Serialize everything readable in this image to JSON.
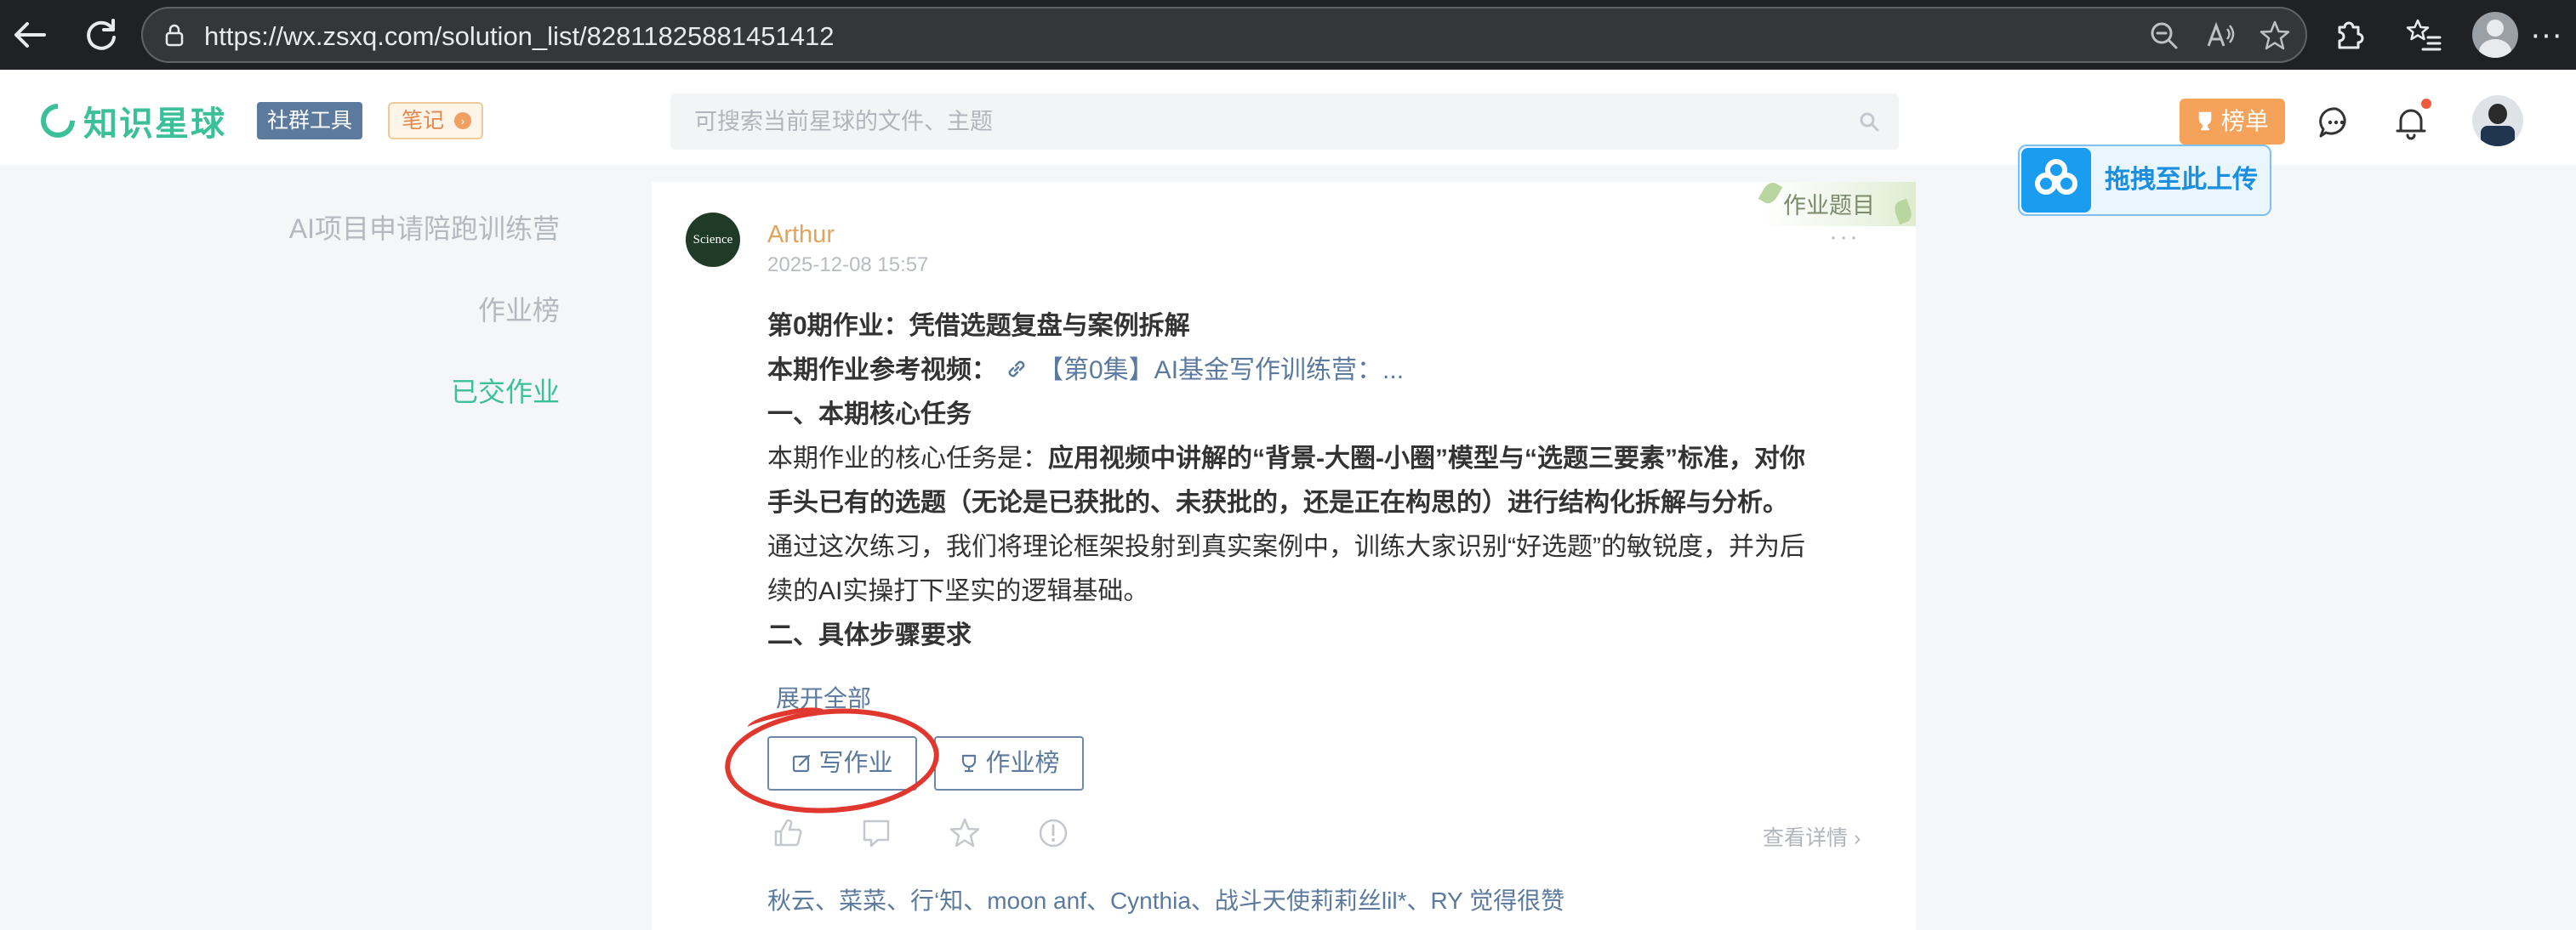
{
  "browser": {
    "url": "https://wx.zsxq.com/solution_list/82811825881451412",
    "more": "···"
  },
  "header": {
    "logo_text": "知识星球",
    "tools_tag": "社群工具",
    "notes_tag": "笔记",
    "search_placeholder": "可搜索当前星球的文件、主题",
    "rank_button": "榜单"
  },
  "upload": {
    "label": "拖拽至此上传"
  },
  "sidebar": {
    "items": [
      {
        "label": "AI项目申请陪跑训练营",
        "active": false
      },
      {
        "label": "作业榜",
        "active": false
      },
      {
        "label": "已交作业",
        "active": true
      }
    ]
  },
  "post": {
    "ribbon": "作业题目",
    "avatar_text": "Science",
    "author": "Arthur",
    "time": "2025-12-08 15:57",
    "title": "第0期作业：凭借选题复盘与案例拆解",
    "ref_label": "本期作业参考视频：",
    "ref_link": "【第0集】AI基金写作训练营：...",
    "section1": "一、本期核心任务",
    "p1_prefix": "本期作业的核心任务是：",
    "p1_bold_a": "应用视频中讲解的“背景-大圈-小圈”模型与“选题三要素”标准，对你",
    "p1_bold_b": "手头已有的选题（无论是已获批的、未获批的，还是正在构思的）进行结构化拆解与分析。",
    "p2_a": "通过这次练习，我们将理论框架投射到真实案例中，训练大家识别“好选题”的敏锐度，并为后",
    "p2_b": "续的AI实操打下坚实的逻辑基础。",
    "section2": "二、具体步骤要求",
    "expand": "展开全部",
    "write_button": "写作业",
    "rank_button": "作业榜",
    "detail_link": "查看详情",
    "likes": "秋云、菜菜、行‘知、moon anf、Cynthia、战斗天使莉莉丝lil*、RY 觉得很赞"
  },
  "colors": {
    "brand": "#3cc09a",
    "link": "#5b7a9e",
    "accent": "#f5a35a",
    "annotation": "#e0382e"
  }
}
